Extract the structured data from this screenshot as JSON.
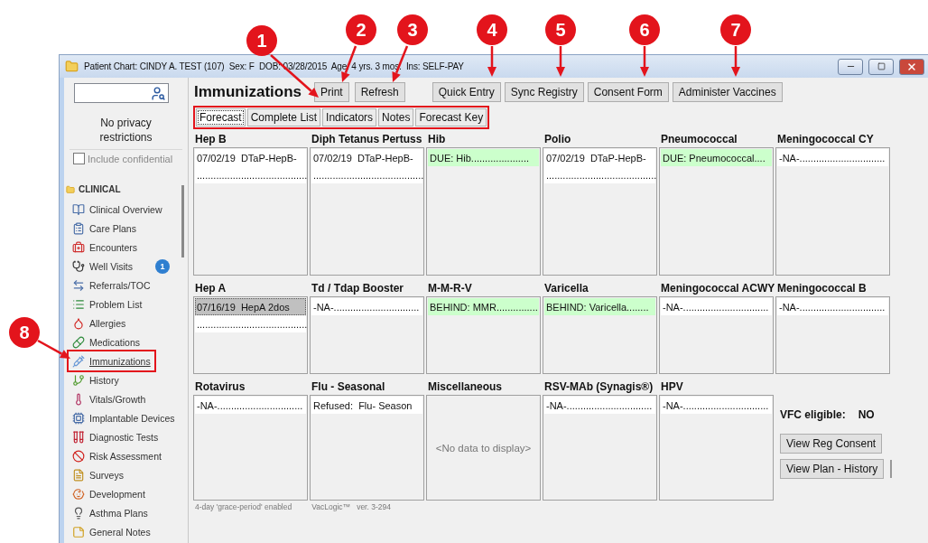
{
  "window": {
    "title": "Patient Chart: CINDY A. TEST (107)  Sex: F  DOB: 03/28/2015  Age: 4 yrs. 3 mos.  Ins: SELF-PAY"
  },
  "sidebar": {
    "privacy": "No privacy restrictions",
    "include_confidential": {
      "label": "Include confidential",
      "checked": false,
      "disabled": true
    },
    "section": "CLINICAL",
    "items": [
      {
        "label": "Clinical Overview",
        "selected": false
      },
      {
        "label": "Care Plans",
        "selected": false
      },
      {
        "label": "Encounters",
        "selected": false
      },
      {
        "label": "Well Visits",
        "selected": false,
        "badge": "1"
      },
      {
        "label": "Referrals/TOC",
        "selected": false
      },
      {
        "label": "Problem List",
        "selected": false
      },
      {
        "label": "Allergies",
        "selected": false
      },
      {
        "label": "Medications",
        "selected": false
      },
      {
        "label": "Immunizations",
        "selected": true
      },
      {
        "label": "History",
        "selected": false
      },
      {
        "label": "Vitals/Growth",
        "selected": false
      },
      {
        "label": "Implantable Devices",
        "selected": false
      },
      {
        "label": "Diagnostic Tests",
        "selected": false
      },
      {
        "label": "Risk Assessment",
        "selected": false
      },
      {
        "label": "Surveys",
        "selected": false
      },
      {
        "label": "Development",
        "selected": false
      },
      {
        "label": "Asthma Plans",
        "selected": false
      },
      {
        "label": "General Notes",
        "selected": false
      }
    ]
  },
  "page": {
    "title": "Immunizations",
    "buttons_left": [
      "Print",
      "Refresh"
    ],
    "buttons_right": [
      "Quick Entry",
      "Sync Registry",
      "Consent Form",
      "Administer Vaccines"
    ]
  },
  "tabs": [
    {
      "label": "Forecast",
      "selected": true
    },
    {
      "label": "Complete List",
      "selected": false
    },
    {
      "label": "Indicators",
      "selected": false
    },
    {
      "label": "Notes",
      "selected": false
    },
    {
      "label": "Forecast Key",
      "selected": false
    }
  ],
  "vaccine_rows": [
    {
      "vaccines": [
        {
          "name": "Hep B",
          "entries": [
            {
              "text": "07/02/19  DTaP-HepB-",
              "kind": "given",
              "selected": false
            },
            {
              "text": "........................................",
              "kind": "given",
              "selected": false
            }
          ]
        },
        {
          "name": "Diph Tetanus Pertuss",
          "entries": [
            {
              "text": "07/02/19  DTaP-HepB-",
              "kind": "given",
              "selected": false
            },
            {
              "text": "........................................",
              "kind": "given",
              "selected": false
            }
          ]
        },
        {
          "name": "Hib",
          "entries": [
            {
              "text": "DUE: Hib.....................",
              "kind": "due",
              "selected": false
            }
          ]
        },
        {
          "name": "Polio",
          "entries": [
            {
              "text": "07/02/19  DTaP-HepB-",
              "kind": "given",
              "selected": false
            },
            {
              "text": "........................................",
              "kind": "given",
              "selected": false
            }
          ]
        },
        {
          "name": "Pneumococcal",
          "entries": [
            {
              "text": "DUE: Pneumococcal....",
              "kind": "due",
              "selected": false
            }
          ]
        },
        {
          "name": "Meningococcal CY",
          "entries": [
            {
              "text": "-NA-...............................",
              "kind": "na",
              "selected": false
            }
          ]
        }
      ]
    },
    {
      "vaccines": [
        {
          "name": "Hep A",
          "entries": [
            {
              "text": "07/16/19  HepA 2dos",
              "kind": "given",
              "selected": true
            },
            {
              "text": "........................................",
              "kind": "given",
              "selected": false
            }
          ]
        },
        {
          "name": "Td / Tdap Booster",
          "entries": [
            {
              "text": "-NA-...............................",
              "kind": "na",
              "selected": false
            }
          ]
        },
        {
          "name": "M-M-R-V",
          "entries": [
            {
              "text": "BEHIND: MMR...............",
              "kind": "due",
              "selected": false
            }
          ]
        },
        {
          "name": "Varicella",
          "entries": [
            {
              "text": "BEHIND: Varicella........",
              "kind": "due",
              "selected": false
            }
          ]
        },
        {
          "name": "Meningococcal ACWY",
          "entries": [
            {
              "text": "-NA-...............................",
              "kind": "na",
              "selected": false
            }
          ]
        },
        {
          "name": "Meningococcal B",
          "entries": [
            {
              "text": "-NA-...............................",
              "kind": "na",
              "selected": false
            }
          ]
        }
      ]
    },
    {
      "vaccines": [
        {
          "name": "Rotavirus",
          "entries": [
            {
              "text": "-NA-...............................",
              "kind": "na",
              "selected": false
            }
          ]
        },
        {
          "name": "Flu - Seasonal",
          "entries": [
            {
              "text": "Refused:  Flu- Season",
              "kind": "refused",
              "selected": false
            }
          ]
        },
        {
          "name": "Miscellaneous",
          "empty_text": "<No data to display>"
        },
        {
          "name": "RSV-MAb (Synagis®)",
          "entries": [
            {
              "text": "-NA-...............................",
              "kind": "na",
              "selected": false
            }
          ]
        },
        {
          "name": "HPV",
          "entries": [
            {
              "text": "-NA-...............................",
              "kind": "na",
              "selected": false
            }
          ]
        }
      ]
    }
  ],
  "vfc": {
    "label": "VFC eligible:",
    "value": "NO"
  },
  "side_buttons": [
    "View Reg Consent",
    "View Plan - History"
  ],
  "footer": {
    "grace": "4-day 'grace-period' enabled",
    "version": "VacLogic™   ver. 3-294"
  },
  "callouts": [
    {
      "label": "1"
    },
    {
      "label": "2"
    },
    {
      "label": "3"
    },
    {
      "label": "4"
    },
    {
      "label": "5"
    },
    {
      "label": "6"
    },
    {
      "label": "7"
    },
    {
      "label": "8"
    }
  ]
}
